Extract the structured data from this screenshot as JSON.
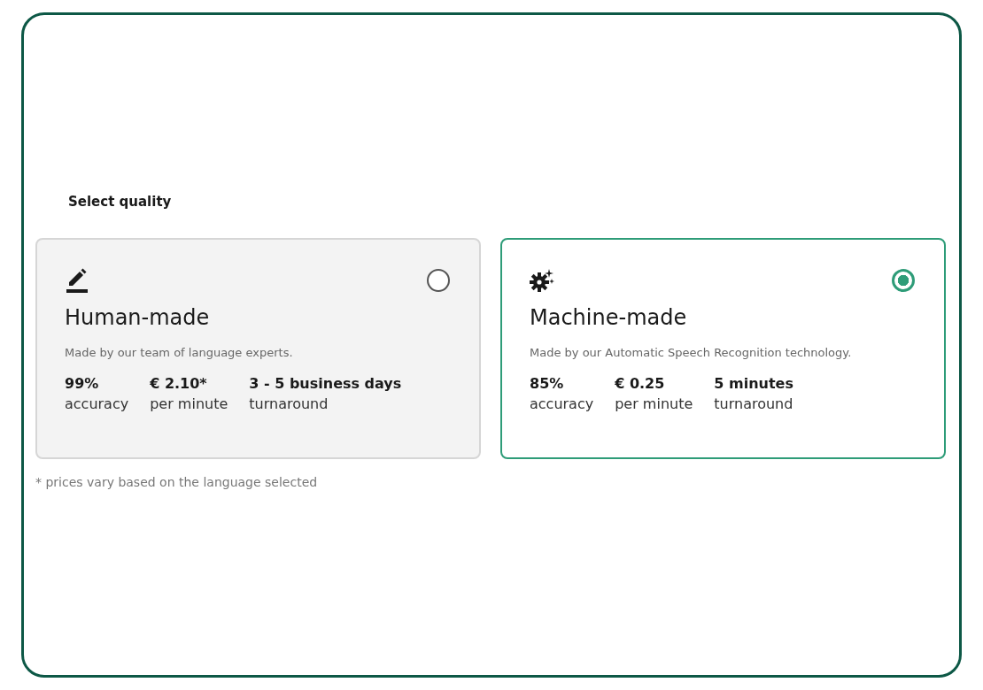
{
  "heading": "Select quality",
  "options": [
    {
      "kind": "pencil",
      "title": "Human-made",
      "description": "Made by our team of language experts.",
      "selected": false,
      "stats": [
        {
          "value": "99%",
          "label": "accuracy"
        },
        {
          "value": "€ 2.10*",
          "label": "per minute"
        },
        {
          "value": "3 - 5 business days",
          "label": "turnaround"
        }
      ]
    },
    {
      "kind": "gear",
      "title": "Machine-made",
      "description": "Made by our Automatic Speech Recognition technology.",
      "selected": true,
      "stats": [
        {
          "value": "85%",
          "label": "accuracy"
        },
        {
          "value": "€ 0.25",
          "label": "per minute"
        },
        {
          "value": "5 minutes",
          "label": "turnaround"
        }
      ]
    }
  ],
  "footnote": "* prices vary based on the language selected"
}
